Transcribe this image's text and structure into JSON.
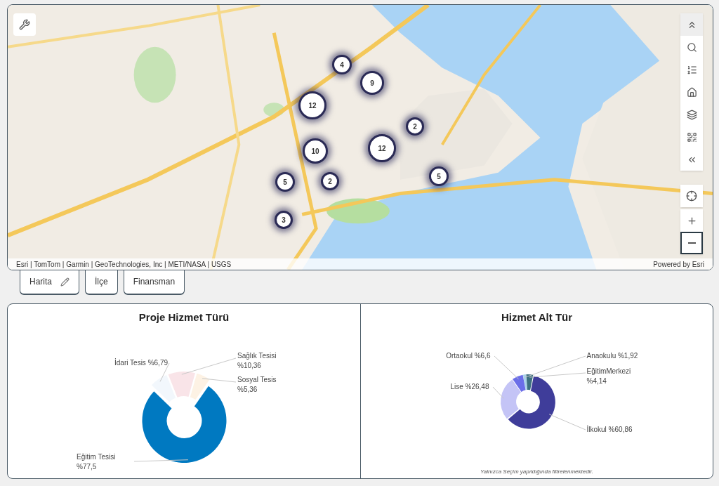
{
  "map": {
    "attribution": "Esri | TomTom | Garmin | GeoTechnologies, Inc | METI/NASA | USGS",
    "powered_by": "Powered by Esri",
    "clusters": [
      {
        "count": "4"
      },
      {
        "count": "9"
      },
      {
        "count": "12"
      },
      {
        "count": "2"
      },
      {
        "count": "10"
      },
      {
        "count": "12"
      },
      {
        "count": "5"
      },
      {
        "count": "2"
      },
      {
        "count": "5"
      },
      {
        "count": "3"
      }
    ]
  },
  "tabs": [
    {
      "label": "Harita",
      "selected": false,
      "editable": true
    },
    {
      "label": "İlçe",
      "selected": false,
      "editable": false
    },
    {
      "label": "Finansman",
      "selected": false,
      "editable": false
    }
  ],
  "charts": [
    {
      "title": "Proje Hizmet Türü",
      "chart_data": {
        "type": "donut",
        "categories": [
          "Sağlık Tesisi %10,36",
          "Sosyal Tesis %5,36",
          "Eğitim Tesisi %77,5",
          "İdari Tesis %6,79"
        ],
        "values": [
          10.36,
          5.36,
          77.5,
          6.79
        ],
        "colors": [
          "#f9e4e8",
          "#fdf2e4",
          "#0079c1",
          "#f2f7fc"
        ]
      }
    },
    {
      "title": "Hizmet Alt Tür",
      "chart_data": {
        "type": "donut",
        "categories": [
          "Anaokulu %1,92",
          "EğitimMerkezi %4,14",
          "İlkokul %60,86",
          "Lise %26,48",
          "Ortaokul %6,6"
        ],
        "values": [
          1.92,
          4.14,
          60.86,
          26.48,
          6.6
        ],
        "colors": [
          "#a9d2e8",
          "#3d7080",
          "#3f3d9a",
          "#c4c4f6",
          "#6b6ee8"
        ]
      },
      "note": "Yalnızca Seçim yapıldığında filtrelenmektedir."
    }
  ]
}
